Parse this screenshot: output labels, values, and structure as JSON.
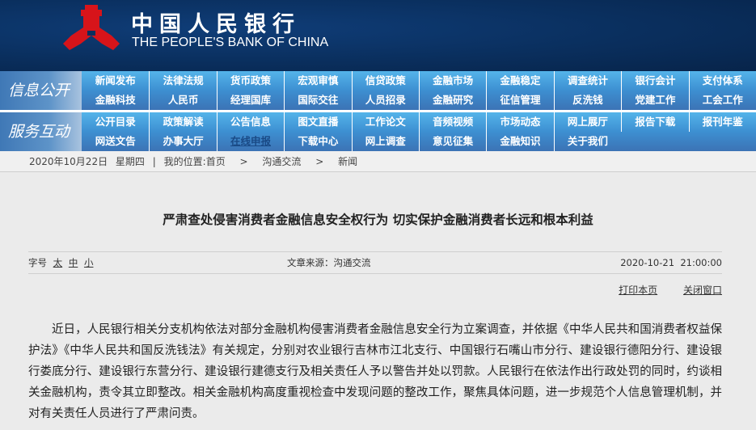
{
  "header": {
    "cn_name": "中国人民银行",
    "en_name": "THE PEOPLE'S BANK OF CHINA",
    "logo_color": "#d7141a"
  },
  "nav": {
    "block1_label": "信息公开",
    "block1_rows": [
      [
        "新闻发布",
        "法律法规",
        "货币政策",
        "宏观审慎",
        "信贷政策",
        "金融市场",
        "金融稳定",
        "调查统计",
        "银行会计",
        "支付体系"
      ],
      [
        "金融科技",
        "人民币",
        "经理国库",
        "国际交往",
        "人员招录",
        "金融研究",
        "征信管理",
        "反洗钱",
        "党建工作",
        "工会工作"
      ]
    ],
    "block2_label": "服务互动",
    "block2_rows": [
      [
        "公开目录",
        "政策解读",
        "公告信息",
        "图文直播",
        "工作论文",
        "音频视频",
        "市场动态",
        "网上展厅",
        "报告下载",
        "报刊年鉴"
      ],
      [
        "网送文告",
        "办事大厅",
        "在线申报",
        "下载中心",
        "网上调查",
        "意见征集",
        "金融知识",
        "关于我们"
      ]
    ]
  },
  "breadcrumb": {
    "date": "2020年10月22日",
    "weekday": "星期四",
    "sep": "|",
    "location_label": "我的位置:",
    "items": [
      "首页",
      "沟通交流",
      "新闻"
    ],
    "arrow": ">"
  },
  "article": {
    "title": "严肃查处侵害消费者金融信息安全权行为 切实保护金融消费者长远和根本利益",
    "font_label": "字号",
    "font_sizes": [
      "太",
      "中",
      "小"
    ],
    "source": "文章来源：沟通交流",
    "datetime": "2020-10-21  21:00:00",
    "print": "打印本页",
    "close": "关闭窗口",
    "body": "近日，人民银行相关分支机构依法对部分金融机构侵害消费者金融信息安全行为立案调查，并依据《中华人民共和国消费者权益保护法》《中华人民共和国反洗钱法》有关规定，分别对农业银行吉林市江北支行、中国银行石嘴山市分行、建设银行德阳分行、建设银行娄底分行、建设银行东营分行、建设银行建德支行及相关责任人予以警告并处以罚款。人民银行在依法作出行政处罚的同时，约谈相关金融机构，责令其立即整改。相关金融机构高度重视检查中发现问题的整改工作，聚焦具体问题，进一步规范个人信息管理机制，并对有关责任人员进行了严肃问责。"
  }
}
